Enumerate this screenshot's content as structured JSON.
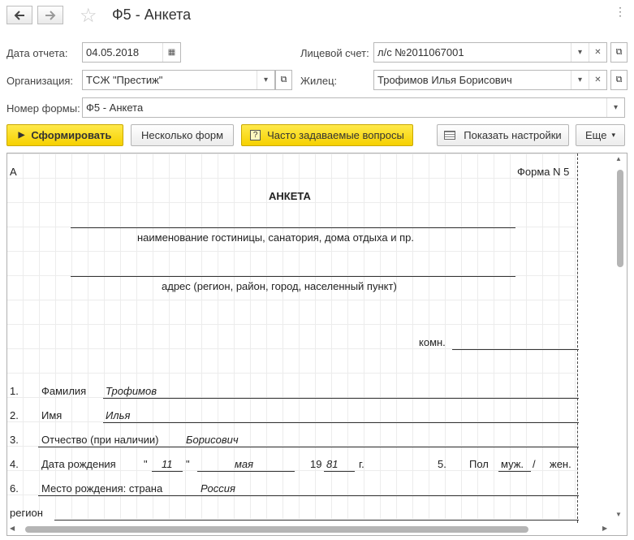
{
  "window": {
    "title": "Ф5 - Анкета"
  },
  "form": {
    "report_date_label": "Дата отчета:",
    "report_date_value": "04.05.2018",
    "account_label": "Лицевой счет:",
    "account_value": "л/с №2011067001",
    "org_label": "Организация:",
    "org_value": "ТСЖ \"Престиж\"",
    "resident_label": "Жилец:",
    "resident_value": "Трофимов Илья Борисович",
    "form_number_label": "Номер формы:",
    "form_number_value": "Ф5 - Анкета"
  },
  "toolbar": {
    "generate": "Сформировать",
    "multiple": "Несколько форм",
    "faq": "Часто задаваемые вопросы",
    "settings": "Показать настройки",
    "more": "Еще"
  },
  "sheet": {
    "corner_a": "А",
    "form_no": "Форма N 5",
    "heading": "АНКЕТА",
    "hotel_caption": "наименование гостиницы, санатория, дома отдыха и пр.",
    "address_caption": "адрес (регион, район, город, населенный пункт)",
    "room_label": "комн.",
    "row1_num": "1.",
    "row1_label": "Фамилия",
    "row1_value": "Трофимов",
    "row2_num": "2.",
    "row2_label": "Имя",
    "row2_value": "Илья",
    "row3_num": "3.",
    "row3_label": "Отчество (при наличии)",
    "row3_value": "Борисович",
    "row4_num": "4.",
    "row4_label": "Дата рождения",
    "quote_open": "\"",
    "birth_day": "11",
    "quote_close": "\"",
    "birth_month": "мая",
    "century": "19",
    "birth_year": "81",
    "year_suffix": "г.",
    "row5_num": "5.",
    "sex_label": "Пол",
    "sex_male": "муж.",
    "sex_slash": "/",
    "sex_female": "жен.",
    "row6_num": "6.",
    "row6_label": "Место рождения: страна",
    "row6_value": "Россия",
    "region_label": "регион"
  }
}
